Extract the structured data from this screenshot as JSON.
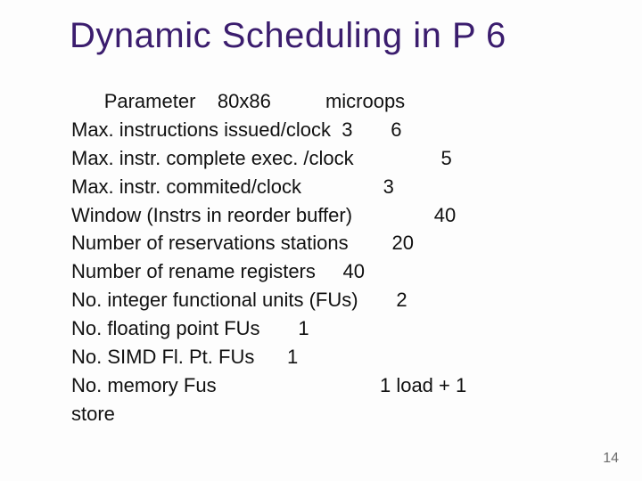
{
  "title": "Dynamic Scheduling in P 6",
  "header": {
    "param": "Parameter",
    "c1": "80x86",
    "c2": "microops"
  },
  "rows": {
    "r1": {
      "label": "Max. instructions issued/clock",
      "v1": "3",
      "v2": "6"
    },
    "r2": {
      "label": "Max. instr. complete exec. /clock",
      "v": "5"
    },
    "r3": {
      "label": "Max. instr. commited/clock",
      "v": "3"
    },
    "r4": {
      "label": "Window (Instrs in reorder buffer)",
      "v": "40"
    },
    "r5": {
      "label": "Number of reservations stations",
      "v": "20"
    },
    "r6": {
      "label": "Number of rename registers",
      "v": "40"
    },
    "r7": {
      "label": "No. integer functional units (FUs)",
      "v": "2"
    },
    "r8": {
      "label": "No. floating point FUs",
      "v": "1"
    },
    "r9": {
      "label": "No. SIMD Fl. Pt. FUs",
      "v": "1"
    },
    "r10a": {
      "label": "No. memory Fus",
      "v": "1 load + 1"
    },
    "r10b": {
      "label": "store"
    }
  },
  "pagenum": "14",
  "mark": ""
}
